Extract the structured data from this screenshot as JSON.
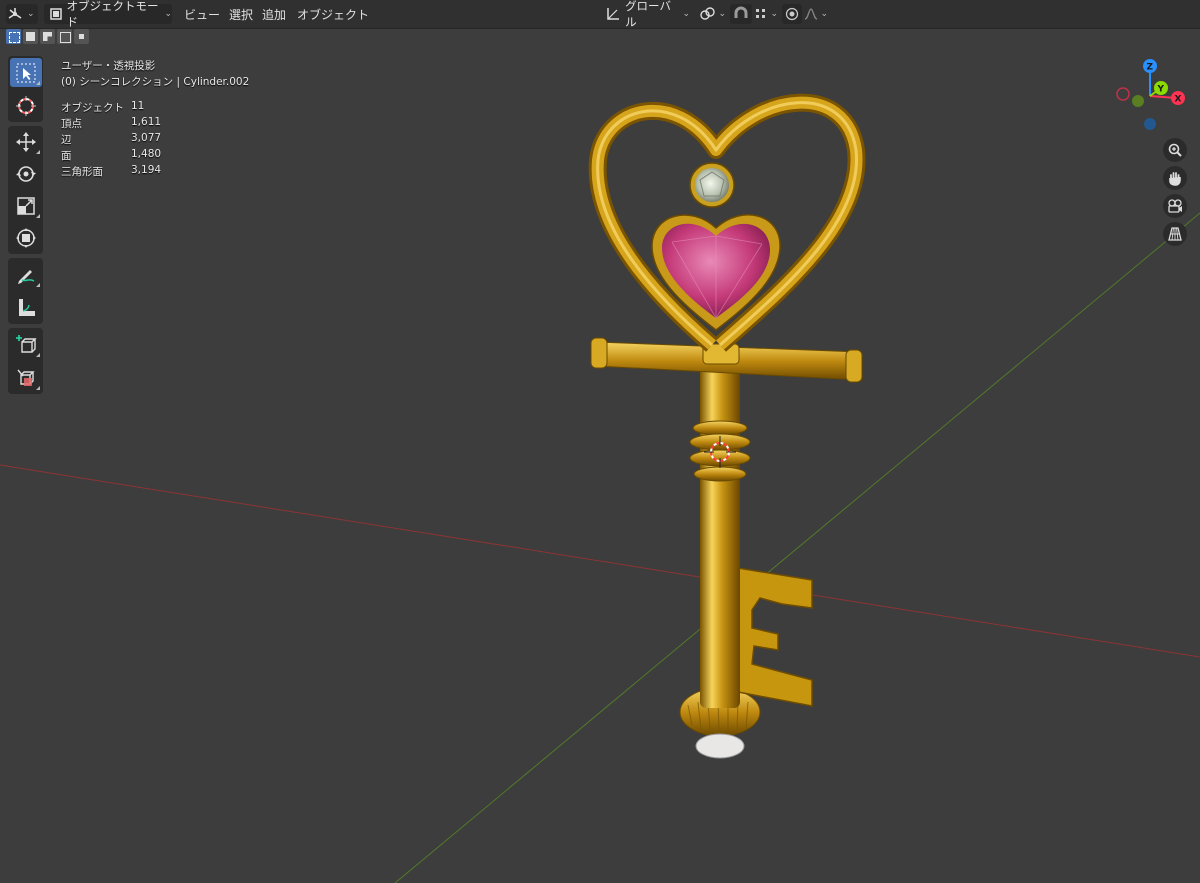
{
  "header": {
    "mode_label": "オブジェクトモード",
    "menu": [
      "ビュー",
      "選択",
      "追加",
      "オブジェクト"
    ],
    "transform_orientation": "グローバル"
  },
  "overlay": {
    "view_name": "ユーザー・透視投影",
    "collection": "(0) シーンコレクション | Cylinder.002"
  },
  "stats": [
    {
      "label": "オブジェクト",
      "value": "11"
    },
    {
      "label": "頂点",
      "value": "1,611"
    },
    {
      "label": "辺",
      "value": "3,077"
    },
    {
      "label": "面",
      "value": "1,480"
    },
    {
      "label": "三角形面",
      "value": "3,194"
    }
  ],
  "gizmo": {
    "x_label": "X",
    "y_label": "Y",
    "z_label": "Z"
  },
  "colors": {
    "accent": "#4772b3",
    "axis_x": "#ff3352",
    "axis_y": "#8bdc00",
    "axis_z": "#2890ff",
    "gold": "#d4a418",
    "ruby": "#c83a78"
  }
}
